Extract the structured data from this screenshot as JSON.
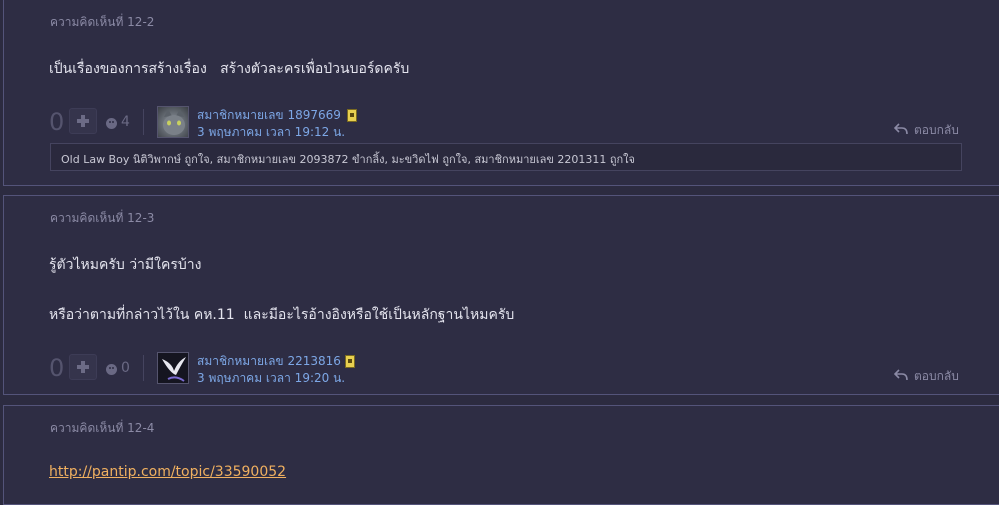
{
  "comments": [
    {
      "label": "ความคิดเห็นที่ 12-2",
      "lines": [
        "เป็นเรื่องของการสร้างเรื่อง   สร้างตัวละครเพื่อป่วนบอร์ดครับ"
      ],
      "votes": "0",
      "emotions": "4",
      "member": "สมาชิกหมายเลข 1897669",
      "time": "3 พฤษภาคม เวลา 19:12 น.",
      "reply": "ตอบกลับ",
      "emotion_list": "Old Law Boy นิติวิพากษ์ ถูกใจ, สมาชิกหมายเลข 2093872 ขำกลิ้ง, มะขวิดไฟ ถูกใจ, สมาชิกหมายเลข 2201311 ถูกใจ"
    },
    {
      "label": "ความคิดเห็นที่ 12-3",
      "lines": [
        "รู้ตัวไหมครับ ว่ามีใครบ้าง",
        "หรือว่าตามที่กล่าวไว้ใน คห.11  และมีอะไรอ้างอิงหรือใช้เป็นหลักฐานไหมครับ"
      ],
      "votes": "0",
      "emotions": "0",
      "member": "สมาชิกหมายเลข 2213816",
      "time": "3 พฤษภาคม เวลา 19:20 น.",
      "reply": "ตอบกลับ"
    },
    {
      "label": "ความคิดเห็นที่ 12-4",
      "link": "http://pantip.com/topic/33590052"
    }
  ],
  "icons": [
    "plus-icon",
    "emotion-icon",
    "member-badge-icon",
    "reply-arrow-icon"
  ],
  "colors": {
    "background": "#2c2b40",
    "border": "#54547a",
    "member_link": "#7da7e6",
    "body_link": "#f0b060"
  }
}
